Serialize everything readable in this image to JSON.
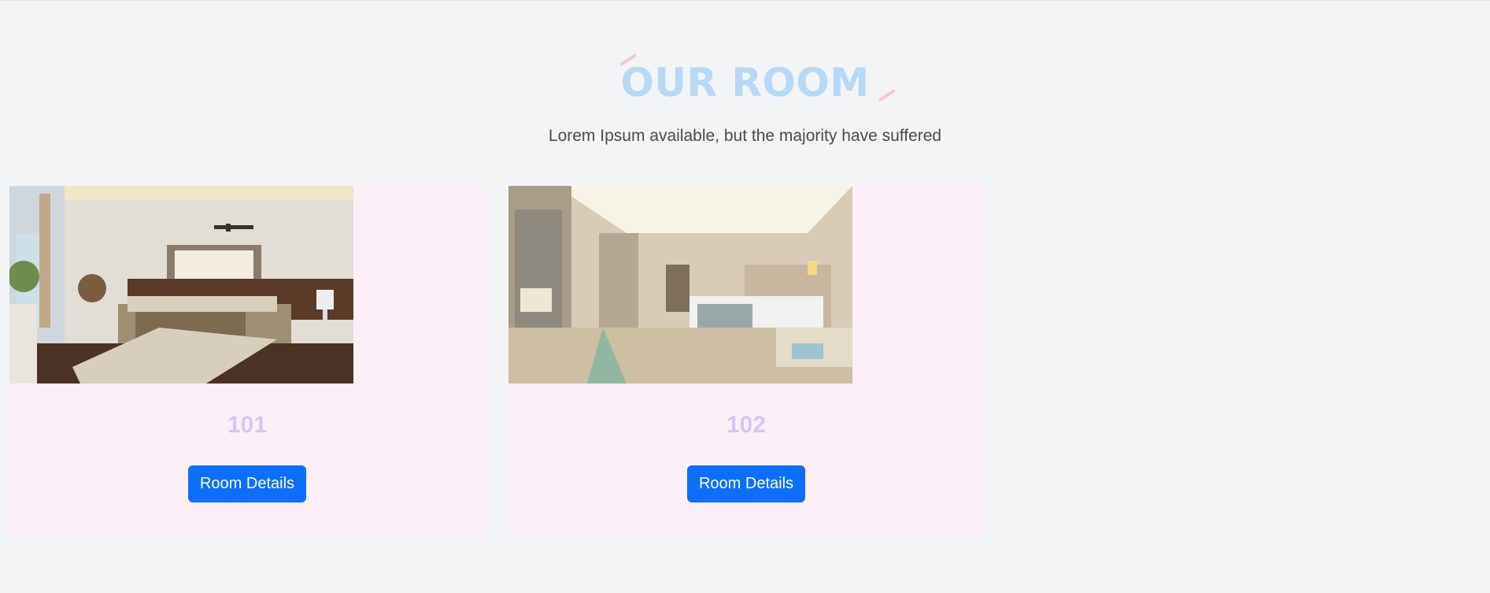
{
  "section": {
    "title": "OUR ROOM",
    "subtitle": "Lorem Ipsum available, but the majority have suffered",
    "colors": {
      "title": "#b9d8f5",
      "accent": "#f6c5d8",
      "card_bg": "#fdeff8",
      "button": "#0d6efd",
      "room_number": "#d7c6f3"
    }
  },
  "rooms": [
    {
      "number": "101",
      "button_label": "Room Details",
      "photo_icon": "bedroom-photo"
    },
    {
      "number": "102",
      "button_label": "Room Details",
      "photo_icon": "hotel-room-photo"
    }
  ]
}
